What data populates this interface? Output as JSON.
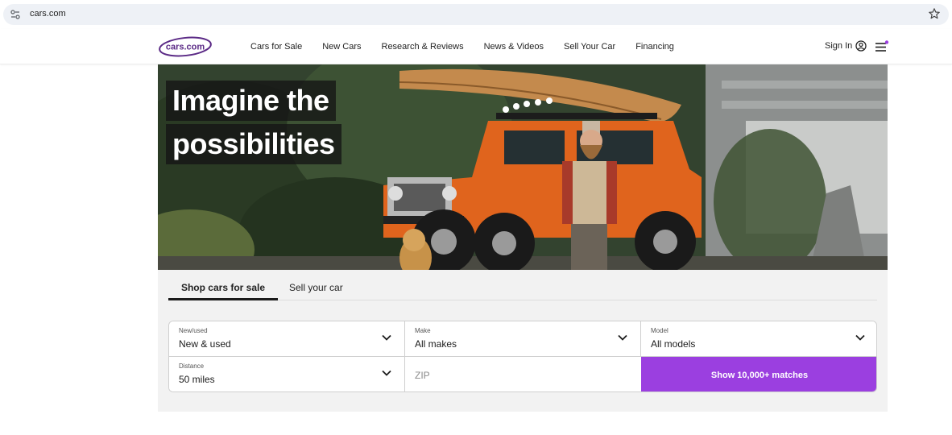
{
  "browser": {
    "url": "cars.com",
    "icons": {
      "site_info": "tune-icon",
      "bookmark": "star-icon"
    }
  },
  "header": {
    "logo_text": "cars.com",
    "nav": [
      {
        "label": "Cars for Sale"
      },
      {
        "label": "New Cars"
      },
      {
        "label": "Research & Reviews"
      },
      {
        "label": "News & Videos"
      },
      {
        "label": "Sell Your Car"
      },
      {
        "label": "Financing"
      }
    ],
    "sign_in": "Sign In",
    "icons": {
      "account": "user-circle-icon",
      "menu": "hamburger-menu-icon"
    }
  },
  "hero": {
    "headline_line1": "Imagine the",
    "headline_line2": "possibilities"
  },
  "search": {
    "tabs": [
      {
        "label": "Shop cars for sale",
        "active": true
      },
      {
        "label": "Sell your car",
        "active": false
      }
    ],
    "fields": {
      "new_used": {
        "label": "New/used",
        "value": "New & used"
      },
      "make": {
        "label": "Make",
        "value": "All makes"
      },
      "model": {
        "label": "Model",
        "value": "All models"
      },
      "distance": {
        "label": "Distance",
        "value": "50 miles"
      },
      "zip": {
        "placeholder": "ZIP"
      }
    },
    "submit_label": "Show 10,000+ matches"
  },
  "colors": {
    "brand_purple": "#9b3fe0",
    "logo_purple": "#5b2a86",
    "panel_bg": "#f2f2f2"
  }
}
